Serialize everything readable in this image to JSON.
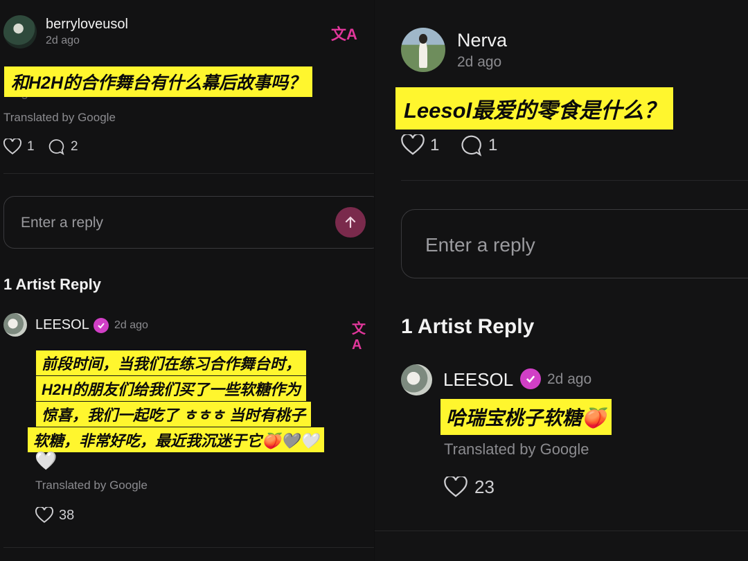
{
  "left": {
    "post": {
      "username": "berryloveusol",
      "time": "2d ago",
      "highlight_text": "和H2H的合作舞台有什么幕后故事吗？",
      "ghost_text": "stage with Hatuka?",
      "translated_by": "Translated by Google",
      "likes": "1",
      "comments": "2"
    },
    "reply_input": {
      "placeholder": "Enter a reply"
    },
    "section_title": "1 Artist Reply",
    "artist_reply": {
      "name": "LEESOL",
      "time": "2d ago",
      "lines": [
        "前段时间，当我们在练习合作舞台时，",
        "H2H的朋友们给我们买了一些软糖作为",
        "惊喜，我们一起吃了 ㅎㅎㅎ 当时有桃子",
        "软糖，非常好吃，最近我沉迷于它🍑🩶🤍"
      ],
      "trailing_emoji": "🤍",
      "translated_by": "Translated by Google",
      "likes": "38"
    }
  },
  "right": {
    "post": {
      "username": "Nerva",
      "time": "2d ago",
      "highlight_text": "Leesol最爱的零食是什么？",
      "likes": "1",
      "comments": "1"
    },
    "reply_input": {
      "placeholder": "Enter a reply"
    },
    "section_title": "1 Artist Reply",
    "artist_reply": {
      "name": "LEESOL",
      "time": "2d ago",
      "highlight_text": "哈瑞宝桃子软糖🍑",
      "translated_by": "Translated by Google",
      "likes": "23"
    }
  },
  "colors": {
    "background": "#121213",
    "highlight": "#fff62e",
    "accent_pink": "#e0369a",
    "verified": "#d13fc6",
    "send_button": "#7a2a4c"
  },
  "icons": [
    "translate-icon",
    "heart-icon",
    "comment-icon",
    "verified-badge-icon",
    "send-arrow-icon",
    "more-icon"
  ]
}
